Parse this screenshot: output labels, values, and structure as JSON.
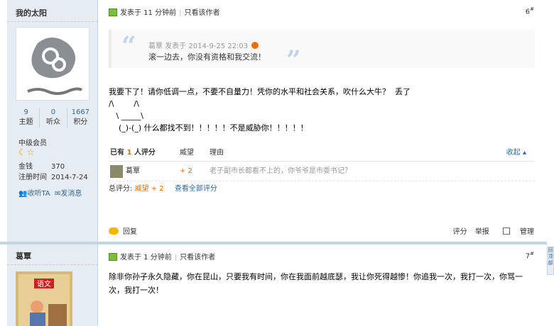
{
  "post1": {
    "username": "我的太阳",
    "stats": [
      {
        "num": "9",
        "label": "主题"
      },
      {
        "num": "0",
        "label": "听众"
      },
      {
        "num": "1667",
        "label": "积分"
      }
    ],
    "level": "中级会员",
    "stars_icon": "moon-star-icon",
    "info": [
      {
        "k": "金钱",
        "v": "370"
      },
      {
        "k": "注册时间",
        "v": "2014-7-24"
      }
    ],
    "follow": "收听TA",
    "message": "发消息",
    "posted": "发表于 11 分钟前",
    "only_author": "只看该作者",
    "floor": "6",
    "floor_suffix": "#",
    "quote_meta": "葛覃 发表于 2014-9-25 22:03",
    "quote_text": "滚一边去，你没有资格和我交流！",
    "body_lines": [
      "我要下了！请你低调一点，不要不自量力！凭你的水平和社会关系，吹什么大牛？  丢了",
      "/\\        /\\",
      "   \\ _____\\",
      "    (_)-(_) 什么都找不到！！！！！不是威胁你！！！！！"
    ],
    "rating": {
      "header_prefix": "已有",
      "count": "1",
      "header_suffix": "人评分",
      "col_prestige": "威望",
      "col_reason": "理由",
      "collapse": "收起",
      "rows": [
        {
          "name": "葛覃",
          "points": "+ 2",
          "reason": "老子副市长都看不上的，你爷爷是市委书记？"
        }
      ],
      "total_label": "总评分:",
      "total_value": "威望 + 2",
      "view_all": "查看全部评分"
    },
    "reply": "回复",
    "rate_btn": "评分",
    "report_btn": "举报",
    "manage_btn": "管理"
  },
  "post2": {
    "username": "葛覃",
    "posted": "发表于 1 分钟前",
    "only_author": "只看该作者",
    "floor": "7",
    "floor_suffix": "#",
    "body": "除非你孙子永久隐藏，你在昆山，只要我有时间，你在我面前越底瑟，我让你死得越惨！你追我一次，我打一次，你骂一次，我打一次！"
  },
  "side_tab": "回顶部"
}
